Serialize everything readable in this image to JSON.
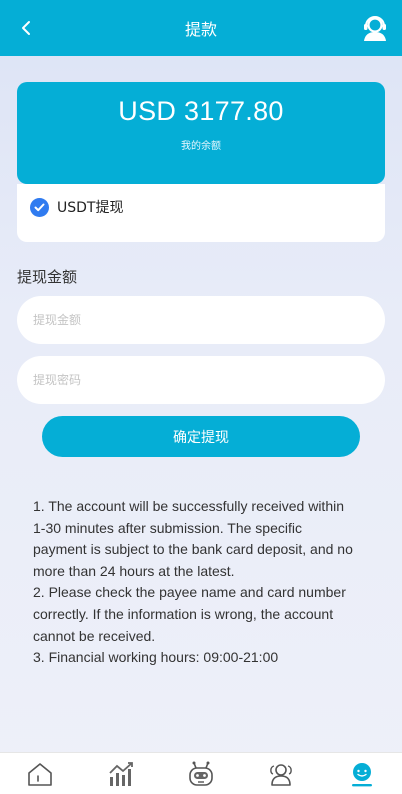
{
  "header": {
    "title": "提款",
    "back_icon": "chevron-left-icon",
    "service_icon": "customer-service-icon"
  },
  "balance": {
    "amount": "USD 3177.80",
    "label": "我的余额"
  },
  "withdraw_method": {
    "label": "USDT提现",
    "checked": true
  },
  "form": {
    "section_title": "提现金额",
    "amount_placeholder": "提现金额",
    "password_placeholder": "提现密码",
    "submit_label": "确定提现"
  },
  "notes": [
    "1. The account will be successfully received within 1-30 minutes after submission. The specific payment is subject to the bank card deposit, and no more than 24 hours at the latest.",
    "2. Please check the payee name and card number correctly. If the information is wrong, the account cannot be received.",
    "3. Financial working hours: 09:00-21:00"
  ],
  "tabbar": {
    "items": [
      "home-icon",
      "market-chart-icon",
      "robot-icon",
      "team-icon",
      "profile-icon"
    ],
    "active_index": 4
  },
  "colors": {
    "primary": "#05aed6",
    "check": "#2f7bf0",
    "tab_inactive": "#555555"
  }
}
